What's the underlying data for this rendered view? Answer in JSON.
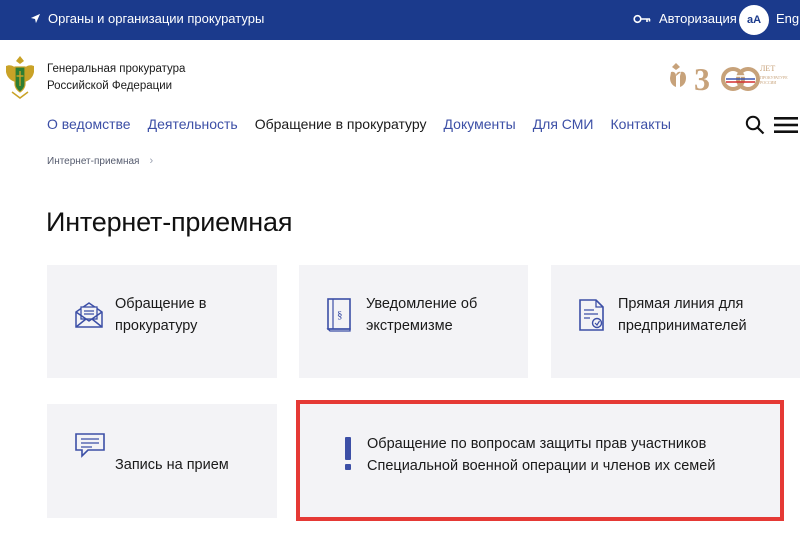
{
  "topbar": {
    "location_text": "Органы и организации прокуратуры",
    "auth_label": "Авторизация",
    "font_toggle": "аА",
    "lang_label": "Eng",
    "background": "#1b3a8c"
  },
  "header": {
    "org_line1": "Генеральная прокуратура",
    "org_line2": "Российской Федерации",
    "anniversary": {
      "number": "300",
      "word": "ЛЕТ",
      "sub": "ПРОКУРАТУРЕ РОССИИ"
    }
  },
  "nav": {
    "items": [
      {
        "label": "О ведомстве"
      },
      {
        "label": "Деятельность"
      },
      {
        "label": "Обращение в прокуратуру",
        "current": true
      },
      {
        "label": "Документы"
      },
      {
        "label": "Для СМИ"
      },
      {
        "label": "Контакты"
      }
    ],
    "search_icon": "search-icon",
    "menu_icon": "hamburger-menu-icon"
  },
  "breadcrumb": {
    "items": [
      "Интернет-приемная"
    ],
    "separator": "›"
  },
  "page_title": "Интернет-приемная",
  "cards": [
    {
      "line1": "Обращение в",
      "line2": "прокуратуру",
      "icon": "envelope-icon"
    },
    {
      "line1": "Уведомление об",
      "line2": "экстремизме",
      "icon": "law-book-icon"
    },
    {
      "line1": "Прямая линия для",
      "line2": "предпринимателей",
      "icon": "document-stamp-icon"
    },
    {
      "line1": "Запись на прием",
      "line2": "",
      "icon": "chat-message-icon"
    },
    {
      "line1": "Обращение по вопросам защиты прав участников",
      "line2": "Специальной военной операции и членов их семей",
      "icon": "exclamation-icon",
      "highlighted": true
    }
  ],
  "colors": {
    "accent": "#3c4fa6",
    "card_bg": "#f3f3f6",
    "highlight": "#e53935"
  }
}
